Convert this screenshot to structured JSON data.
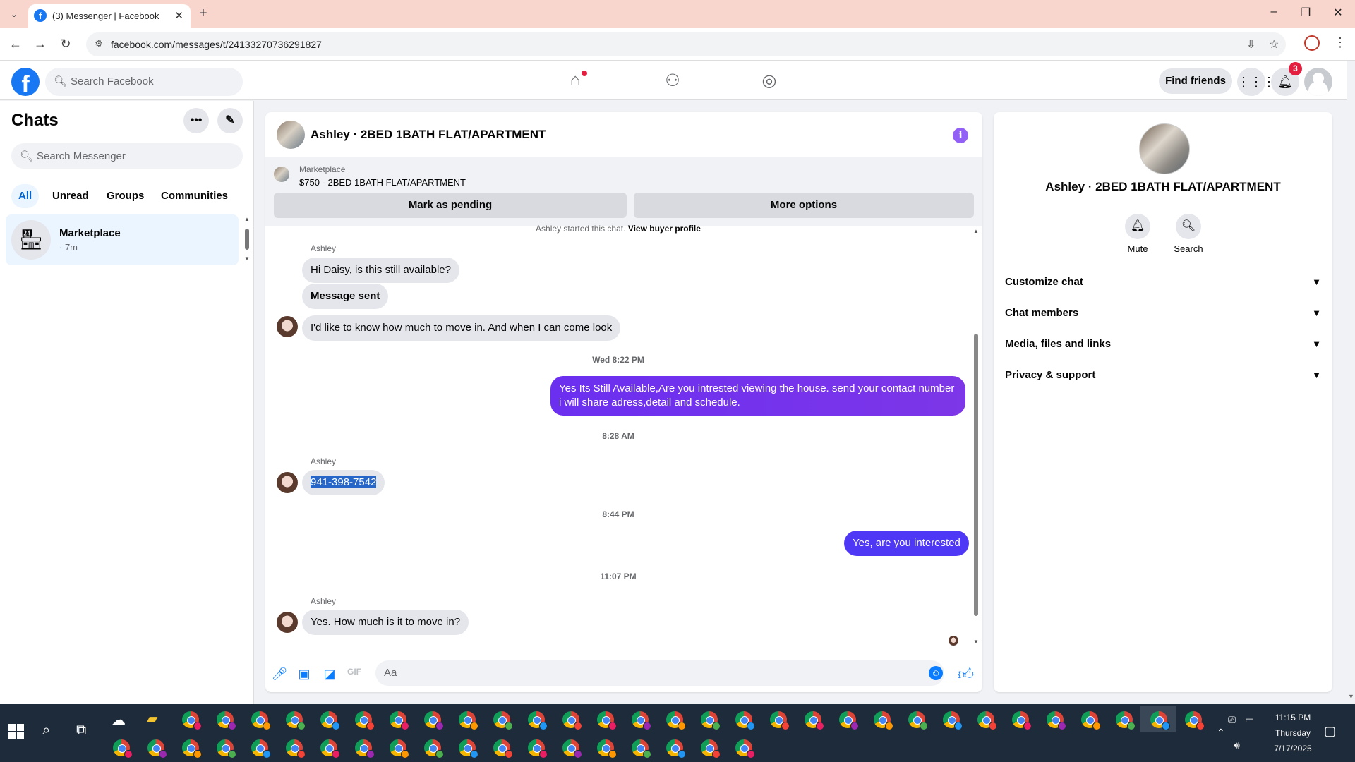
{
  "browser": {
    "tab_title": "(3) Messenger | Facebook",
    "url": "facebook.com/messages/t/24133270736291827"
  },
  "fb": {
    "search_placeholder": "Search Facebook",
    "find_friends": "Find friends",
    "notifications_count": "3"
  },
  "chats": {
    "title": "Chats",
    "search_placeholder": "Search Messenger",
    "filters": [
      "All",
      "Unread",
      "Groups",
      "Communities"
    ],
    "items": [
      {
        "name": "Marketplace",
        "time": "· 7m"
      }
    ]
  },
  "conversation": {
    "title": "Ashley · 2BED 1BATH FLAT/APARTMENT",
    "marketplace_label": "Marketplace",
    "marketplace_item": "$750 - 2BED 1BATH FLAT/APARTMENT",
    "mark_pending": "Mark as pending",
    "more_options": "More options",
    "started_text": "Ashley started this chat.",
    "view_buyer": "View buyer profile",
    "messages": {
      "sender1": "Ashley",
      "m1": "Hi Daisy, is this still available?",
      "m2": "Message sent",
      "m3": "I'd like to know how much to move in. And when I can come look",
      "ts1": "Wed 8:22 PM",
      "m4": "Yes Its Still Available,Are you intrested viewing the house. send your contact number i will share adress,detail and schedule.",
      "ts2": "8:28 AM",
      "sender2": "Ashley",
      "m5": "941-398-7542",
      "ts3": "8:44 PM",
      "m6": "Yes, are you interested",
      "ts4": "11:07 PM",
      "sender3": "Ashley",
      "m7": "Yes. How much is it to move in?"
    },
    "composer_placeholder": "Aa"
  },
  "info_panel": {
    "name": "Ashley · 2BED 1BATH FLAT/APARTMENT",
    "mute": "Mute",
    "search": "Search",
    "sections": [
      "Customize chat",
      "Chat members",
      "Media, files and links",
      "Privacy & support"
    ]
  },
  "taskbar": {
    "time": "11:15 PM",
    "day": "Thursday",
    "date": "7/17/2025"
  }
}
